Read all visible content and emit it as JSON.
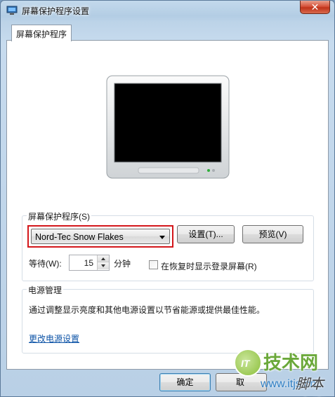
{
  "window": {
    "title": "屏幕保护程序设置",
    "close_symbol": "✕"
  },
  "tab": {
    "label": "屏幕保护程序"
  },
  "screensaver": {
    "group_label": "屏幕保护程序(S)",
    "selected": "Nord-Tec Snow Flakes",
    "settings_button": "设置(T)...",
    "preview_button": "预览(V)",
    "wait_label": "等待(W):",
    "wait_value": "15",
    "wait_unit": "分钟",
    "resume_checkbox_label": "在恢复时显示登录屏幕(R)",
    "resume_checked": false
  },
  "power": {
    "group_label": "电源管理",
    "description": "通过调整显示亮度和其他电源设置以节省能源或提供最佳性能。",
    "link": "更改电源设置"
  },
  "footer": {
    "ok_button": "确定",
    "cancel_button": "取"
  },
  "watermark": {
    "logo": "IT",
    "title": "技术网",
    "url": "www.itjs.cn",
    "sub": "脚本之家"
  },
  "colors": {
    "highlight_border": "#d3171b",
    "link": "#0b52a6"
  }
}
